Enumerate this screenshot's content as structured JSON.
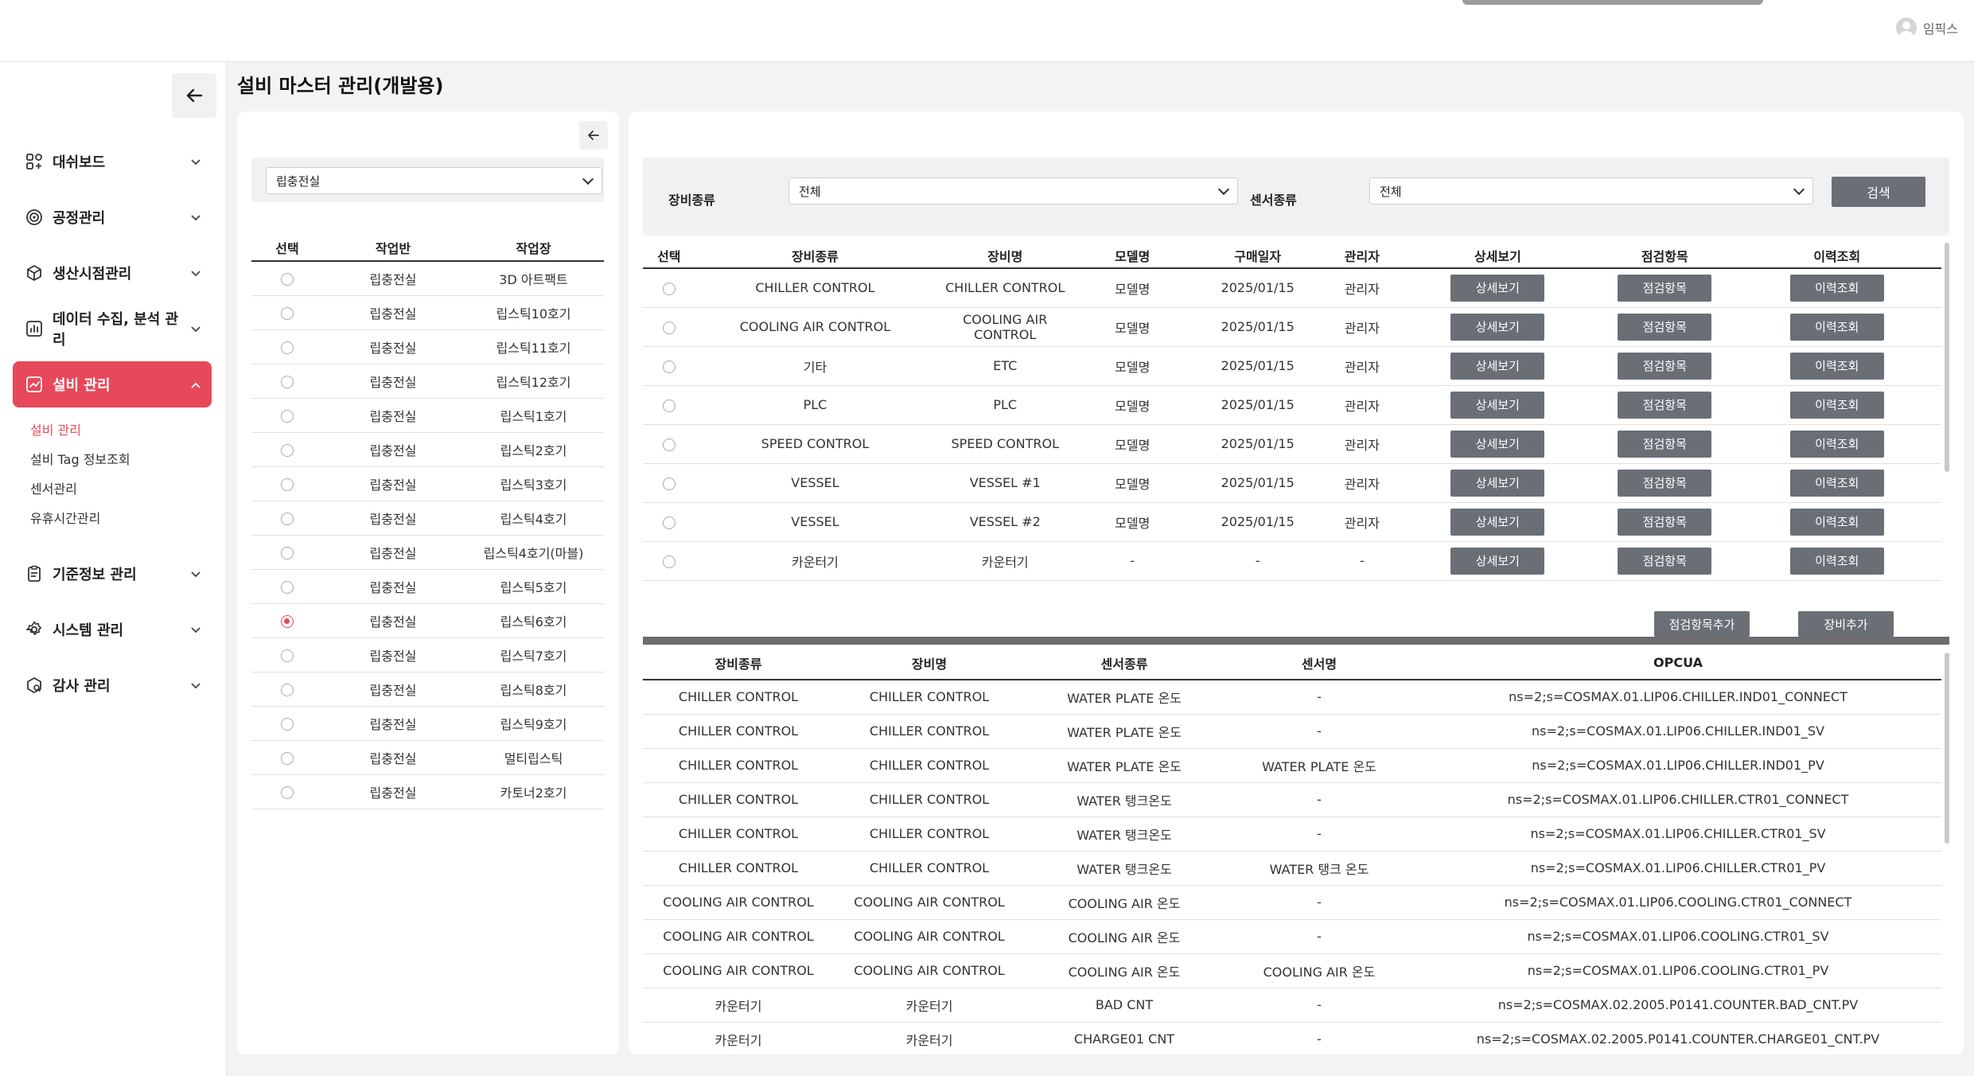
{
  "header": {
    "user_name": "임픽스"
  },
  "sidebar": {
    "items": [
      {
        "label": "대쉬보드",
        "icon": "dashboard-icon"
      },
      {
        "label": "공정관리",
        "icon": "process-icon"
      },
      {
        "label": "생산시점관리",
        "icon": "box-icon"
      },
      {
        "label": "데이터 수집, 분석 관리",
        "icon": "chart-icon"
      },
      {
        "label": "설비 관리",
        "icon": "equipment-icon",
        "active": true
      },
      {
        "label": "기준정보 관리",
        "icon": "clipboard-icon"
      },
      {
        "label": "시스템 관리",
        "icon": "gear-icon"
      },
      {
        "label": "감사 관리",
        "icon": "audit-icon"
      }
    ],
    "submenu": [
      "설비 관리",
      "설비 Tag 정보조회",
      "센서관리",
      "유휴시간관리"
    ]
  },
  "page": {
    "title": "설비 마스터 관리(개발용)"
  },
  "left_panel": {
    "select_value": "립충전실",
    "columns": [
      "선택",
      "작업반",
      "작업장"
    ],
    "rows": [
      [
        "립충전실",
        "3D 아트팩트"
      ],
      [
        "립충전실",
        "립스틱10호기"
      ],
      [
        "립충전실",
        "립스틱11호기"
      ],
      [
        "립충전실",
        "립스틱12호기"
      ],
      [
        "립충전실",
        "립스틱1호기"
      ],
      [
        "립충전실",
        "립스틱2호기"
      ],
      [
        "립충전실",
        "립스틱3호기"
      ],
      [
        "립충전실",
        "립스틱4호기"
      ],
      [
        "립충전실",
        "립스틱4호기(마블)"
      ],
      [
        "립충전실",
        "립스틱5호기"
      ],
      [
        "립충전실",
        "립스틱6호기"
      ],
      [
        "립충전실",
        "립스틱7호기"
      ],
      [
        "립충전실",
        "립스틱8호기"
      ],
      [
        "립충전실",
        "립스틱9호기"
      ],
      [
        "립충전실",
        "멀티립스틱"
      ],
      [
        "립충전실",
        "카토너2호기"
      ]
    ],
    "selected_index": 10
  },
  "filter": {
    "equip_type_label": "장비종류",
    "equip_type_value": "전체",
    "sensor_type_label": "센서종류",
    "sensor_type_value": "전체",
    "search_label": "검색"
  },
  "equipment_table": {
    "columns": [
      "선택",
      "장비종류",
      "장비명",
      "모델명",
      "구매일자",
      "관리자",
      "상세보기",
      "점검항목",
      "이력조회"
    ],
    "button_labels": {
      "detail": "상세보기",
      "inspect": "점검항목",
      "history": "이력조회"
    },
    "rows": [
      [
        "CHILLER CONTROL",
        "CHILLER CONTROL",
        "모델명",
        "2025/01/15",
        "관리자"
      ],
      [
        "COOLING AIR CONTROL",
        "COOLING AIR CONTROL",
        "모델명",
        "2025/01/15",
        "관리자"
      ],
      [
        "기타",
        "ETC",
        "모델명",
        "2025/01/15",
        "관리자"
      ],
      [
        "PLC",
        "PLC",
        "모델명",
        "2025/01/15",
        "관리자"
      ],
      [
        "SPEED CONTROL",
        "SPEED CONTROL",
        "모델명",
        "2025/01/15",
        "관리자"
      ],
      [
        "VESSEL",
        "VESSEL #1",
        "모델명",
        "2025/01/15",
        "관리자"
      ],
      [
        "VESSEL",
        "VESSEL #2",
        "모델명",
        "2025/01/15",
        "관리자"
      ],
      [
        "카운터기",
        "카운터기",
        "-",
        "-",
        "-"
      ]
    ]
  },
  "actions": {
    "add_inspection": "점검항목추가",
    "add_equipment": "장비추가"
  },
  "sensor_table": {
    "columns": [
      "장비종류",
      "장비명",
      "센서종류",
      "센서명",
      "OPCUA"
    ],
    "rows": [
      [
        "CHILLER CONTROL",
        "CHILLER CONTROL",
        "WATER PLATE 온도",
        "-",
        "ns=2;s=COSMAX.01.LIP06.CHILLER.IND01_CONNECT"
      ],
      [
        "CHILLER CONTROL",
        "CHILLER CONTROL",
        "WATER PLATE 온도",
        "-",
        "ns=2;s=COSMAX.01.LIP06.CHILLER.IND01_SV"
      ],
      [
        "CHILLER CONTROL",
        "CHILLER CONTROL",
        "WATER PLATE 온도",
        "WATER PLATE 온도",
        "ns=2;s=COSMAX.01.LIP06.CHILLER.IND01_PV"
      ],
      [
        "CHILLER CONTROL",
        "CHILLER CONTROL",
        "WATER 탱크온도",
        "-",
        "ns=2;s=COSMAX.01.LIP06.CHILLER.CTR01_CONNECT"
      ],
      [
        "CHILLER CONTROL",
        "CHILLER CONTROL",
        "WATER 탱크온도",
        "-",
        "ns=2;s=COSMAX.01.LIP06.CHILLER.CTR01_SV"
      ],
      [
        "CHILLER CONTROL",
        "CHILLER CONTROL",
        "WATER 탱크온도",
        "WATER 탱크 온도",
        "ns=2;s=COSMAX.01.LIP06.CHILLER.CTR01_PV"
      ],
      [
        "COOLING AIR CONTROL",
        "COOLING AIR CONTROL",
        "COOLING AIR 온도",
        "-",
        "ns=2;s=COSMAX.01.LIP06.COOLING.CTR01_CONNECT"
      ],
      [
        "COOLING AIR CONTROL",
        "COOLING AIR CONTROL",
        "COOLING AIR 온도",
        "-",
        "ns=2;s=COSMAX.01.LIP06.COOLING.CTR01_SV"
      ],
      [
        "COOLING AIR CONTROL",
        "COOLING AIR CONTROL",
        "COOLING AIR 온도",
        "COOLING AIR 온도",
        "ns=2;s=COSMAX.01.LIP06.COOLING.CTR01_PV"
      ],
      [
        "카운터기",
        "카운터기",
        "BAD CNT",
        "-",
        "ns=2;s=COSMAX.02.2005.P0141.COUNTER.BAD_CNT.PV"
      ],
      [
        "카운터기",
        "카운터기",
        "CHARGE01 CNT",
        "-",
        "ns=2;s=COSMAX.02.2005.P0141.COUNTER.CHARGE01_CNT.PV"
      ]
    ]
  },
  "colors": {
    "accent": "#e8495a",
    "button": "#6a6f76"
  }
}
